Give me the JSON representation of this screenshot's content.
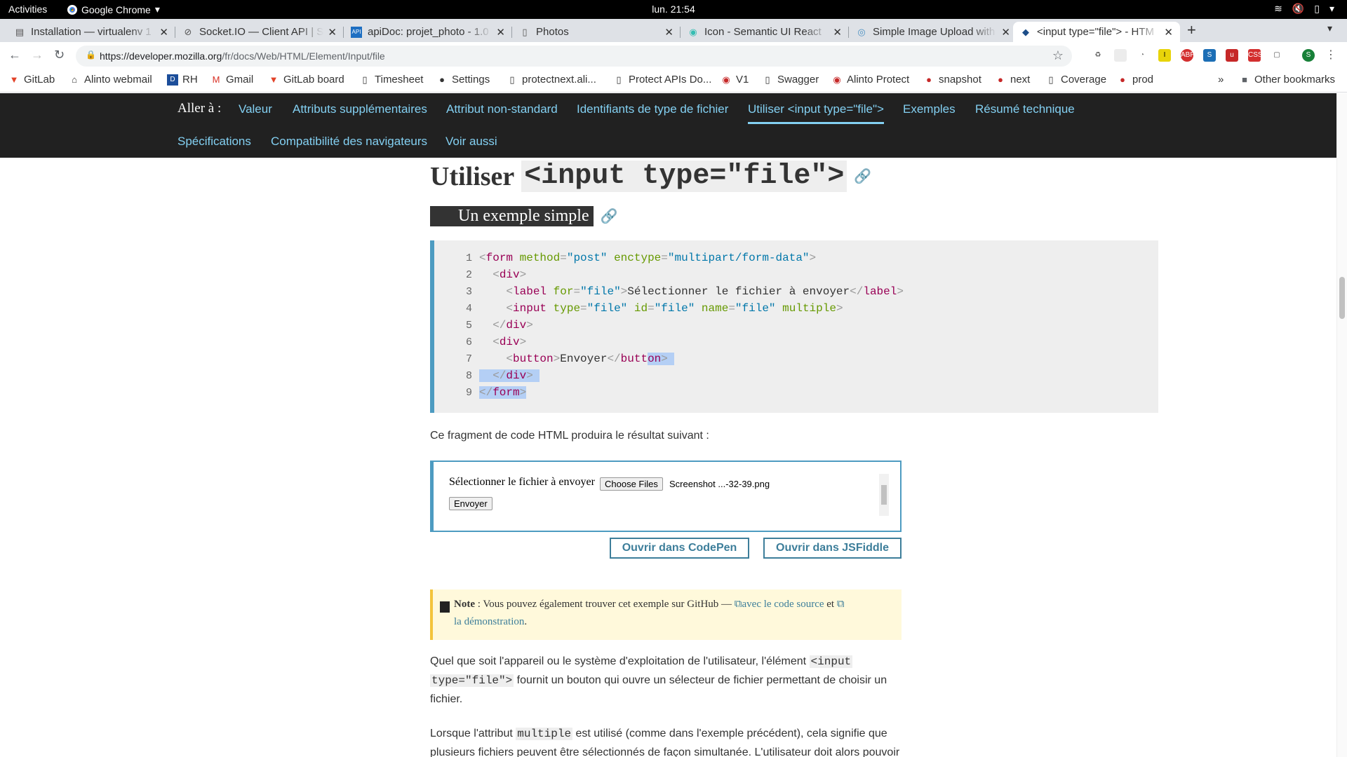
{
  "system": {
    "activities": "Activities",
    "app": "Google Chrome",
    "clock": "lun. 21:54"
  },
  "tabs": [
    {
      "title": "Installation — virtualenv 1",
      "icon": "book-icon"
    },
    {
      "title": "Socket.IO — Client API | S",
      "icon": "socketio-icon"
    },
    {
      "title": "apiDoc: projet_photo - 1.0",
      "icon": "api-icon"
    },
    {
      "title": "Photos",
      "icon": "page-icon"
    },
    {
      "title": "Icon - Semantic UI React",
      "icon": "semantic-icon"
    },
    {
      "title": "Simple Image Upload with",
      "icon": "eye-icon"
    },
    {
      "title": "<input type=\"file\"> - HTM",
      "icon": "mdn-icon"
    }
  ],
  "omnibox": {
    "url_host": "https://developer.mozilla.org",
    "url_path": "/fr/docs/Web/HTML/Element/Input/file"
  },
  "bookmarks": [
    {
      "label": "GitLab"
    },
    {
      "label": "Alinto webmail"
    },
    {
      "label": "RH"
    },
    {
      "label": "Gmail"
    },
    {
      "label": "GitLab board"
    },
    {
      "label": "Timesheet"
    },
    {
      "label": "Settings"
    },
    {
      "label": "protectnext.ali..."
    },
    {
      "label": "Protect APIs Do..."
    },
    {
      "label": "V1"
    },
    {
      "label": "Swagger"
    },
    {
      "label": "Alinto Protect"
    },
    {
      "label": "snapshot"
    },
    {
      "label": "next"
    },
    {
      "label": "Coverage"
    },
    {
      "label": "prod"
    }
  ],
  "bookmarks_more": "»",
  "other_bookmarks": "Other bookmarks",
  "jumpnav": {
    "label": "Aller à :",
    "links": [
      "Valeur",
      "Attributs supplémentaires",
      "Attribut non-standard",
      "Identifiants de type de fichier",
      "Utiliser <input type=\"file\">",
      "Exemples",
      "Résumé technique",
      "Spécifications",
      "Compatibilité des navigateurs",
      "Voir aussi"
    ]
  },
  "content": {
    "h2_prefix": "Utiliser",
    "h2_code": "<input type=\"file\">",
    "h3": "Un exemple simple",
    "line_numbers": [
      "1",
      "2",
      "3",
      "4",
      "5",
      "6",
      "7",
      "8",
      "9"
    ],
    "code": {
      "l1_tag": "form",
      "l1_a1": "method",
      "l1_v1": "\"post\"",
      "l1_a2": "enctype",
      "l1_v2": "\"multipart/form-data\"",
      "div": "div",
      "l3_tag": "label",
      "l3_a": "for",
      "l3_v": "\"file\"",
      "l3_text": "Sélectionner le fichier à envoyer",
      "l4_tag": "input",
      "l4_a1": "type",
      "l4_v1": "\"file\"",
      "l4_a2": "id",
      "l4_v2": "\"file\"",
      "l4_a3": "name",
      "l4_v3": "\"file\"",
      "l4_a4": "multiple",
      "l7_tag": "button",
      "l7_text": "Envoyer",
      "l7_close_a": "butt",
      "l7_close_b": "on"
    },
    "result_intro": "Ce fragment de code HTML produira le résultat suivant :",
    "result": {
      "label": "Sélectionner le fichier à envoyer",
      "choose": "Choose Files",
      "filename": "Screenshot ...-32-39.png",
      "send": "Envoyer"
    },
    "codepen": "Ouvrir dans CodePen",
    "jsfiddle": "Ouvrir dans JSFiddle",
    "note": {
      "bold": "Note",
      "text": " : Vous pouvez également trouver cet exemple sur GitHub — ",
      "link1": "avec le code source",
      "and": " et ",
      "link2": "la démonstration",
      "end": "."
    },
    "p1_a": "Quel que soit l'appareil ou le système d'exploitation de l'utilisateur, l'élément ",
    "p1_code1": "<input",
    "p1_code2": "type=\"file\">",
    "p1_b": " fournit un bouton qui ouvre un sélecteur de fichier permettant de choisir un",
    "p1_c": "fichier.",
    "p2_a": "Lorsque l'attribut ",
    "p2_code": "multiple",
    "p2_b": " est utilisé (comme dans l'exemple précédent), cela signifie que",
    "p2_c": "plusieurs fichiers peuvent être sélectionnés de façon simultanée. L'utilisateur doit alors pouvoir"
  }
}
